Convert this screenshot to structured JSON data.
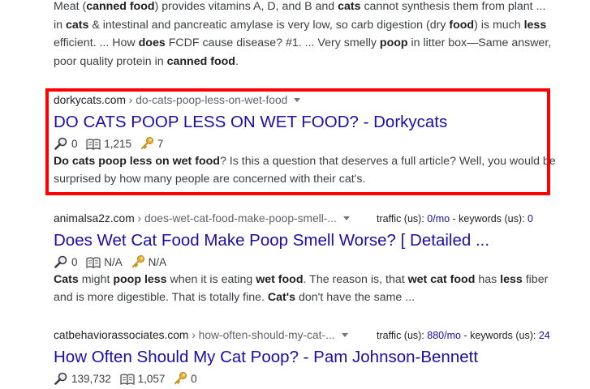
{
  "top_snippet": {
    "parts": [
      {
        "t": "Meat (",
        "b": false
      },
      {
        "t": "canned food",
        "b": true
      },
      {
        "t": ") provides vitamins A, D, and B and ",
        "b": false
      },
      {
        "t": "cats",
        "b": true
      },
      {
        "t": " cannot synthesis them from plant ... in ",
        "b": false
      },
      {
        "t": "cats",
        "b": true
      },
      {
        "t": " & intestinal and pancreatic amylase is very low, so carb digestion (dry ",
        "b": false
      },
      {
        "t": "food",
        "b": true
      },
      {
        "t": ") is much ",
        "b": false
      },
      {
        "t": "less",
        "b": true
      },
      {
        "t": " efficient. ... How ",
        "b": false
      },
      {
        "t": "does",
        "b": true
      },
      {
        "t": " FCDF cause disease? #1. ... Very smelly ",
        "b": false
      },
      {
        "t": "poop",
        "b": true
      },
      {
        "t": " in litter box—Same answer, poor quality protein in ",
        "b": false
      },
      {
        "t": "canned food",
        "b": true
      },
      {
        "t": ".",
        "b": false
      }
    ]
  },
  "results": [
    {
      "domain": "dorkycats.com",
      "crumb": " › do-cats-poop-less-on-wet-food",
      "title": "DO CATS POOP LESS ON WET FOOD? - Dorkycats",
      "stats": {
        "search": "0",
        "book": "1,215",
        "key": "7"
      },
      "desc": [
        {
          "t": "Do cats poop less on wet food",
          "b": true
        },
        {
          "t": "? Is this a question that deserves a full article? Well, you would be surprised by how many people are concerned with their cat's.",
          "b": false
        }
      ]
    },
    {
      "domain": "animalsa2z.com",
      "crumb": " › does-wet-cat-food-make-poop-smell-...",
      "traffic": {
        "label": "traffic (us): ",
        "value": "0/mo",
        "kw_label": " - keywords (us): ",
        "kw_value": "0"
      },
      "title": "Does Wet Cat Food Make Poop Smell Worse? [ Detailed ...",
      "stats": {
        "search": "0",
        "book": "N/A",
        "key": "N/A"
      },
      "desc": [
        {
          "t": "Cats",
          "b": true
        },
        {
          "t": " might ",
          "b": false
        },
        {
          "t": "poop less",
          "b": true
        },
        {
          "t": " when it is eating ",
          "b": false
        },
        {
          "t": "wet food",
          "b": true
        },
        {
          "t": ". The reason is, that ",
          "b": false
        },
        {
          "t": "wet cat food",
          "b": true
        },
        {
          "t": " has ",
          "b": false
        },
        {
          "t": "less",
          "b": true
        },
        {
          "t": " fiber and is more digestible. That is totally fine. ",
          "b": false
        },
        {
          "t": "Cat's",
          "b": true
        },
        {
          "t": " don't have the same ...",
          "b": false
        }
      ]
    },
    {
      "domain": "catbehaviorassociates.com",
      "crumb": " › how-often-should-my-cat-...",
      "traffic": {
        "label": "traffic (us): ",
        "value": "880/mo",
        "kw_label": " - keywords (us): ",
        "kw_value": "24"
      },
      "title": "How Often Should My Cat Poop? - Pam Johnson-Bennett",
      "stats": {
        "search": "139,732",
        "book": "1,057",
        "key": "0"
      }
    }
  ],
  "colors": {
    "highlight": "#ff0000",
    "link": "#1a0dab",
    "text": "#3c4043"
  },
  "icons": {
    "search": "magnifier-icon",
    "book": "book-icon",
    "key": "key-icon"
  }
}
